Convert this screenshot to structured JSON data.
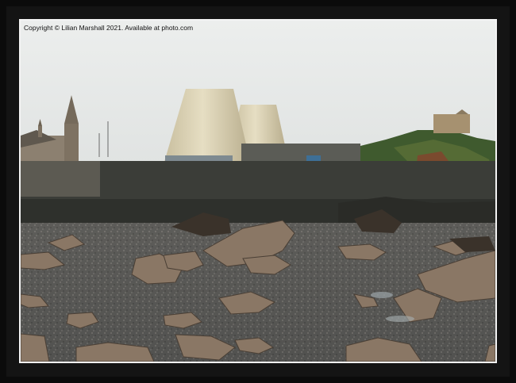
{
  "photo": {
    "copyright_text": "Copyright © Lilian Marshall 2021. Available at photo.com"
  },
  "colors": {
    "frame": "#0b0b0b",
    "sky": "#e6e8e7",
    "domes": "#ddd3b6",
    "wall": "#3d3f3a",
    "pebbles": "#5a5a58",
    "rocks": "#8b7866"
  }
}
